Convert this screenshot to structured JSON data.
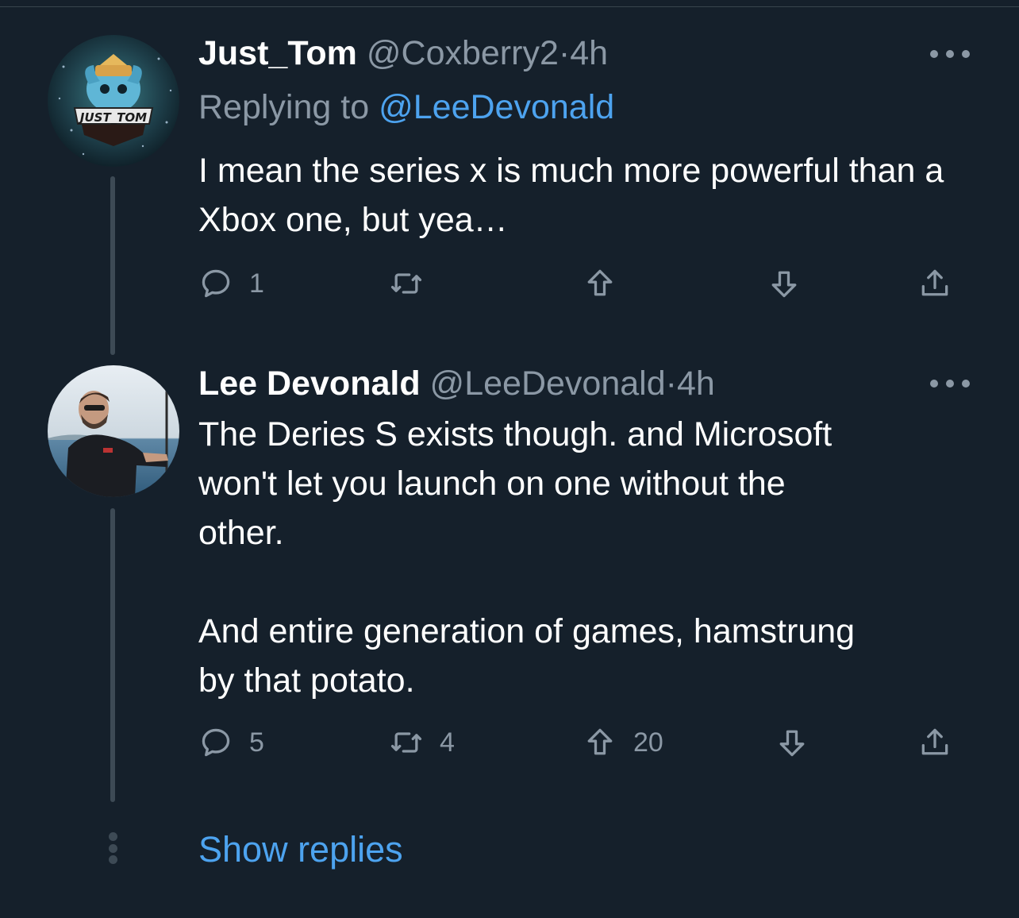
{
  "tweets": [
    {
      "display_name": "Just_Tom",
      "handle": "@Coxberry2",
      "separator": "·",
      "time": "4h",
      "replying_prefix": "Replying to",
      "replying_to": "@LeeDevonald",
      "avatar_text": "JUST_TOM",
      "text": "I mean the series x is much more powerful than a Xbox one, but yea…",
      "actions": {
        "reply_count": "1",
        "retweet_count": "",
        "upvote_count": "",
        "downvote_count": ""
      }
    },
    {
      "display_name": "Lee Devonald",
      "handle": "@LeeDevonald",
      "separator": "·",
      "time": "4h",
      "text": "The Deries S exists though. and Microsoft\nwon't let you launch on one without the\nother.\n\nAnd entire generation of games, hamstrung\nby that potato.",
      "actions": {
        "reply_count": "5",
        "retweet_count": "4",
        "upvote_count": "20",
        "downvote_count": ""
      }
    }
  ],
  "show_replies_label": "Show replies",
  "colors": {
    "background": "#15202b",
    "muted": "#8b98a5",
    "accent": "#4da3ef",
    "thread_line": "#3d4a55"
  },
  "icons": [
    "more-icon",
    "reply-icon",
    "retweet-icon",
    "upvote-icon",
    "downvote-icon",
    "share-icon"
  ]
}
